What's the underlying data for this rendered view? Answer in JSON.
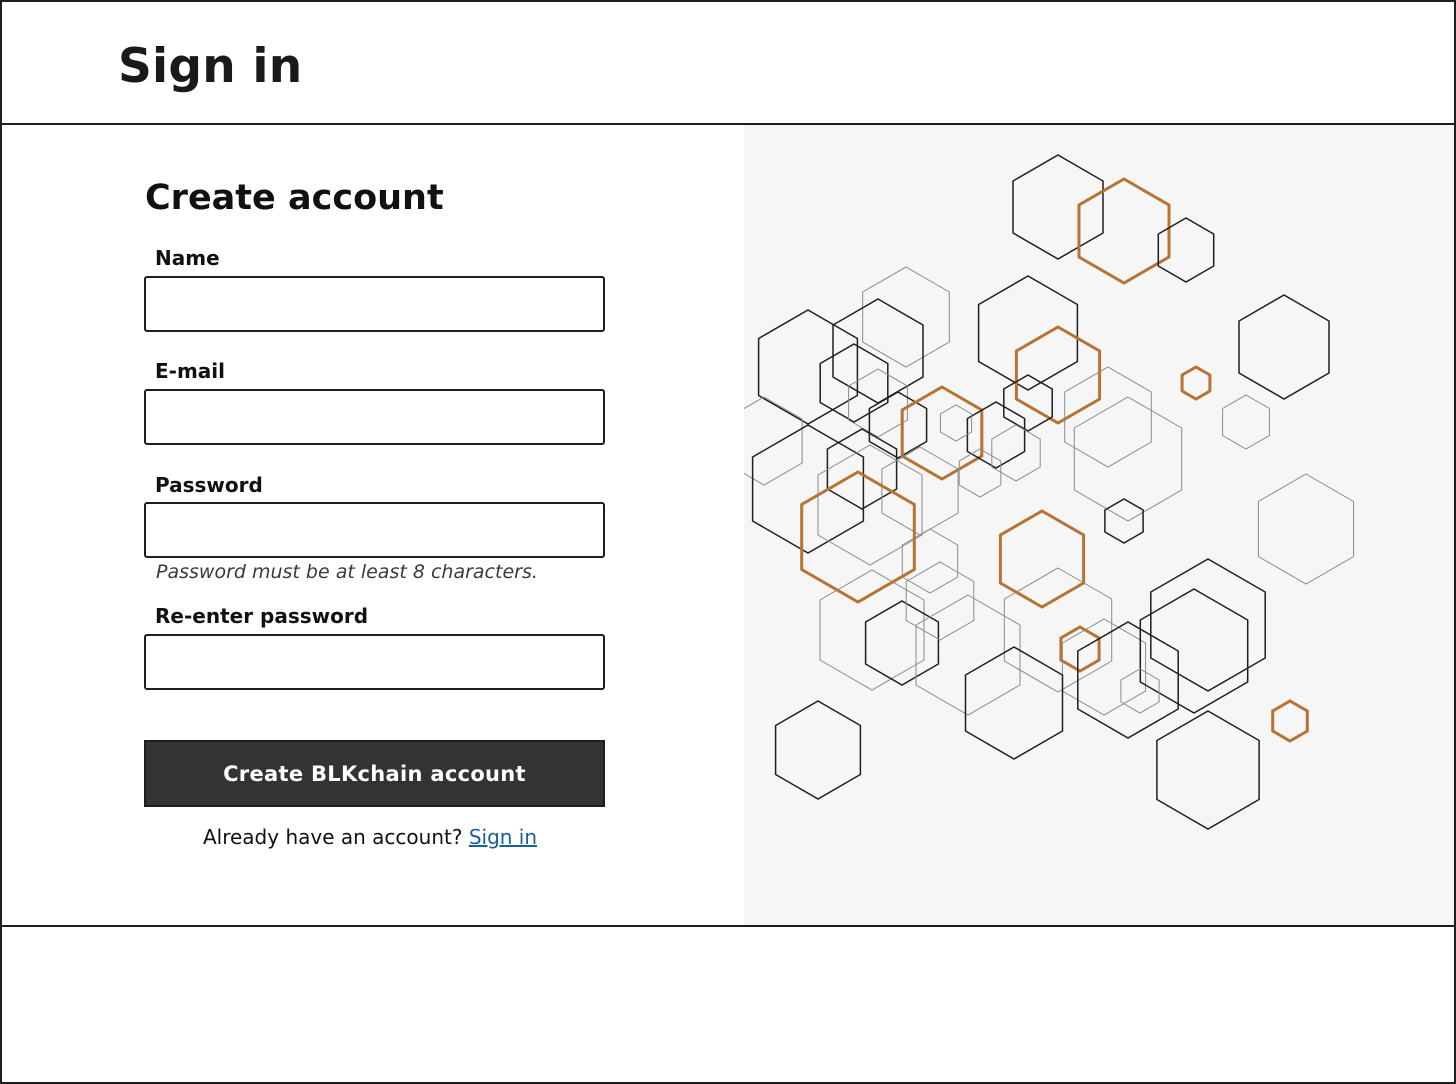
{
  "header": {
    "title": "Sign in"
  },
  "form": {
    "heading": "Create account",
    "fields": [
      {
        "label": "Name",
        "value": "",
        "placeholder": ""
      },
      {
        "label": "E-mail",
        "value": "",
        "placeholder": ""
      },
      {
        "label": "Password",
        "value": "",
        "placeholder": ""
      },
      {
        "label": "Re-enter password",
        "value": "",
        "placeholder": ""
      }
    ],
    "password_hint": "Password must be at least 8 characters.",
    "submit_label": "Create BLKchain account",
    "signin_prompt": "Already have an account?",
    "signin_link": "Sign in"
  },
  "decoration": {
    "icon": "hexagon-pattern-icon",
    "colors": {
      "dark": "#1e1e1e",
      "gray": "#8a8a8a",
      "accent": "#b87333"
    }
  }
}
